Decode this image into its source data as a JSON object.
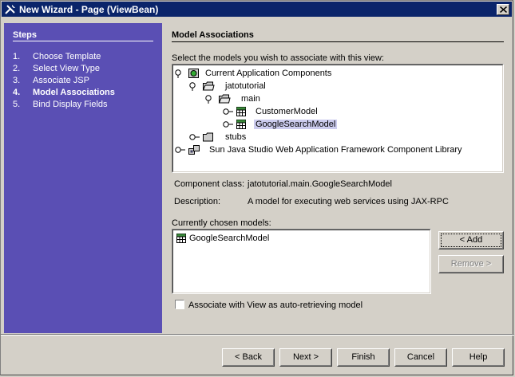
{
  "window": {
    "title": "New Wizard - Page (ViewBean)"
  },
  "steps": {
    "header": "Steps",
    "items": [
      {
        "num": "1.",
        "label": "Choose Template"
      },
      {
        "num": "2.",
        "label": "Select View Type"
      },
      {
        "num": "3.",
        "label": "Associate JSP"
      },
      {
        "num": "4.",
        "label": "Model Associations"
      },
      {
        "num": "5.",
        "label": "Bind Display Fields"
      }
    ],
    "current_index": 3
  },
  "panel": {
    "title": "Model Associations",
    "instruction": "Select the models you wish to associate with this view:",
    "tree": [
      {
        "label": "Current Application Components",
        "icon": "components-icon",
        "expanded": true
      },
      {
        "label": "jatotutorial",
        "icon": "folder-icon",
        "expanded": true
      },
      {
        "label": "main",
        "icon": "folder-icon",
        "expanded": true
      },
      {
        "label": "CustomerModel",
        "icon": "model-icon"
      },
      {
        "label": "GoogleSearchModel",
        "icon": "model-icon",
        "selected": true
      },
      {
        "label": "stubs",
        "icon": "folder-icon",
        "expanded": false
      },
      {
        "label": "Sun Java Studio Web Application Framework Component Library",
        "icon": "library-icon",
        "expanded": false
      }
    ],
    "component_class_label": "Component class:",
    "component_class_value": "jatotutorial.main.GoogleSearchModel",
    "description_label": "Description:",
    "description_value": "A model for executing web services using JAX-RPC",
    "chosen_label": "Currently chosen models:",
    "chosen_models": [
      "GoogleSearchModel"
    ],
    "add_button": "< Add",
    "remove_button": "Remove >",
    "checkbox_label": "Associate with View as auto-retrieving model",
    "checkbox_checked": false
  },
  "footer": {
    "back": "< Back",
    "next": "Next >",
    "finish": "Finish",
    "cancel": "Cancel",
    "help": "Help"
  }
}
